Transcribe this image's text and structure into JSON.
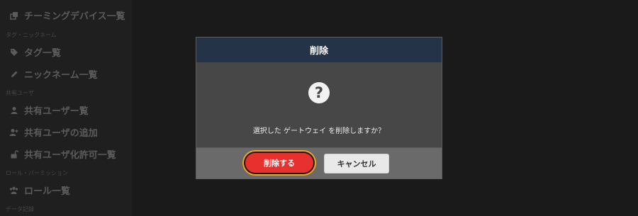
{
  "sidebar": {
    "items": [
      {
        "label": "チーミングデバイス一覧",
        "icon": "clone-icon"
      },
      {
        "label": "タグ一覧",
        "icon": "tag-icon"
      },
      {
        "label": "ニックネーム一覧",
        "icon": "pencil-icon"
      },
      {
        "label": "共有ユーザー覧",
        "icon": "user-icon"
      },
      {
        "label": "共有ユーザの追加",
        "icon": "user-plus-icon"
      },
      {
        "label": "共有ユーザ化許可一覧",
        "icon": "unlock-icon"
      },
      {
        "label": "ロール一覧",
        "icon": "users-icon"
      }
    ],
    "sections": [
      "タグ・ニックネーム",
      "共有ユーザ",
      "ロール・パーミッション",
      "データ記録"
    ]
  },
  "modal": {
    "title": "削除",
    "icon": "question-icon",
    "message": "選択した ゲートウェイ を削除しますか？",
    "delete_label": "削除する",
    "cancel_label": "キャンセル"
  },
  "colors": {
    "header_bg": "#243347",
    "delete_button": "#e8312f",
    "highlight_ring": "#f4a31f"
  }
}
